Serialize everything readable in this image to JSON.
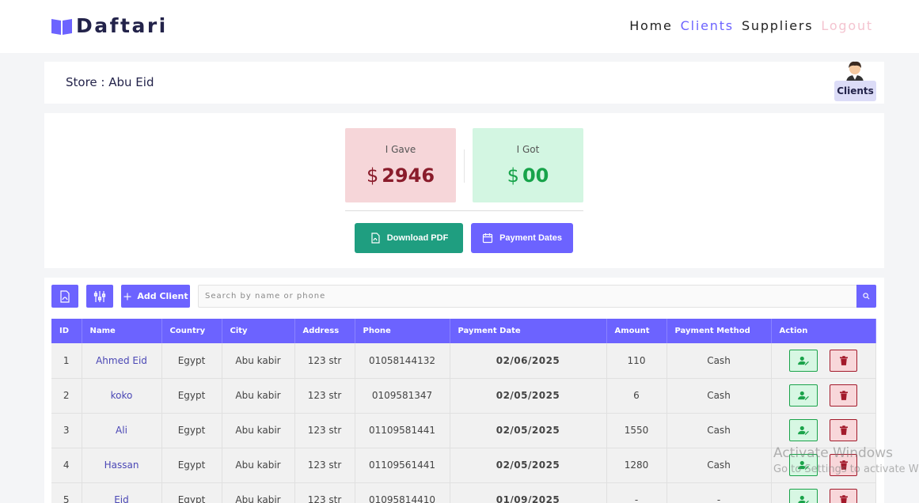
{
  "brand": {
    "name": "Daftari"
  },
  "nav": {
    "home": "Home",
    "clients": "Clients",
    "suppliers": "Suppliers",
    "logout": "Logout"
  },
  "store": {
    "title": "Store : Abu Eid",
    "badge": "Clients"
  },
  "summary": {
    "gave_label": "I Gave",
    "gave_currency": "$",
    "gave_amount": "2946",
    "got_label": "I Got",
    "got_currency": "$",
    "got_amount": "00",
    "download_label": "Download PDF",
    "dates_label": "Payment Dates"
  },
  "toolbar": {
    "add_label": "Add Client",
    "search_placeholder": "Search by name or phone"
  },
  "table": {
    "headers": [
      "ID",
      "Name",
      "Country",
      "City",
      "Address",
      "Phone",
      "Payment Date",
      "Amount",
      "Payment Method",
      "Action"
    ],
    "rows": [
      [
        "1",
        "Ahmed Eid",
        "Egypt",
        "Abu kabir",
        "123 str",
        "01058144132",
        "02/06/2025",
        "110",
        "Cash"
      ],
      [
        "2",
        "koko",
        "Egypt",
        "Abu kabir",
        "123 str",
        "0109581347",
        "02/05/2025",
        "6",
        "Cash"
      ],
      [
        "3",
        "Ali",
        "Egypt",
        "Abu kabir",
        "123 str",
        "01109581441",
        "02/05/2025",
        "1550",
        "Cash"
      ],
      [
        "4",
        "Hassan",
        "Egypt",
        "Abu kabir",
        "123 str",
        "01109561441",
        "02/05/2025",
        "1280",
        "Cash"
      ],
      [
        "5",
        "Eid",
        "Egypt",
        "Abu kabir",
        "123 str",
        "01095814410",
        "01/09/2025",
        "-",
        "-"
      ]
    ]
  },
  "watermark": {
    "line1": "Activate Windows",
    "line2": "Go to Settings to activate Windows."
  },
  "colors": {
    "accent": "#6c63ff",
    "success": "#1f9e80",
    "danger": "#8a1c2b"
  }
}
